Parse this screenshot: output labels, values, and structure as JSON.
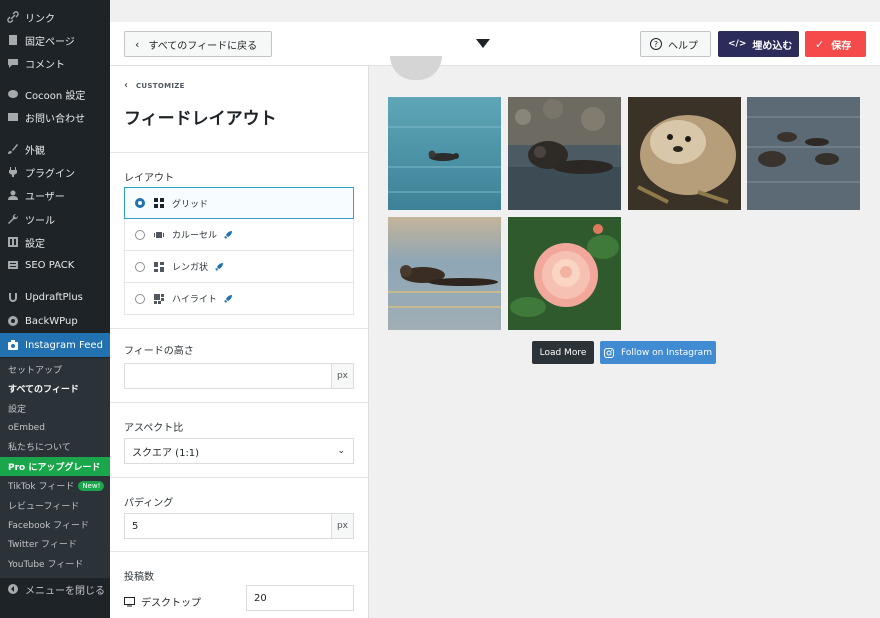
{
  "sidebar": {
    "items": [
      {
        "label": "リンク",
        "icon": "link-icon"
      },
      {
        "label": "固定ページ",
        "icon": "page-icon"
      },
      {
        "label": "コメント",
        "icon": "comment-icon"
      },
      {
        "label": "Cocoon 設定",
        "icon": "cocoon-icon"
      },
      {
        "label": "お問い合わせ",
        "icon": "mail-icon"
      },
      {
        "label": "外観",
        "icon": "brush-icon"
      },
      {
        "label": "プラグイン",
        "icon": "plugin-icon"
      },
      {
        "label": "ユーザー",
        "icon": "user-icon"
      },
      {
        "label": "ツール",
        "icon": "wrench-icon"
      },
      {
        "label": "設定",
        "icon": "settings-icon"
      },
      {
        "label": "SEO PACK",
        "icon": "seo-icon"
      },
      {
        "label": "UpdraftPlus",
        "icon": "updraft-icon"
      },
      {
        "label": "BackWPup",
        "icon": "backwpup-icon"
      },
      {
        "label": "Instagram Feed",
        "icon": "camera-icon"
      }
    ],
    "submenu": [
      {
        "label": "セットアップ"
      },
      {
        "label": "すべてのフィード"
      },
      {
        "label": "設定"
      },
      {
        "label": "oEmbed"
      },
      {
        "label": "私たちについて"
      },
      {
        "label": "Pro にアップグレード"
      },
      {
        "label": "TikTok フィード",
        "badge": "New!"
      },
      {
        "label": "レビューフィード"
      },
      {
        "label": "Facebook フィード"
      },
      {
        "label": "Twitter フィード"
      },
      {
        "label": "YouTube フィード"
      }
    ],
    "collapse_label": "メニューを閉じる"
  },
  "header": {
    "back_label": "すべてのフィードに戻る",
    "help_label": "ヘルプ",
    "embed_label": "埋め込む",
    "save_label": "保存"
  },
  "panel": {
    "breadcrumb": "CUSTOMIZE",
    "title": "フィードレイアウト",
    "layout_label": "レイアウト",
    "layout_options": [
      {
        "label": "グリッド",
        "selected": true,
        "pro": false
      },
      {
        "label": "カルーセル",
        "selected": false,
        "pro": true
      },
      {
        "label": "レンガ状",
        "selected": false,
        "pro": true
      },
      {
        "label": "ハイライト",
        "selected": false,
        "pro": true
      }
    ],
    "height_label": "フィードの高さ",
    "height_value": "",
    "height_unit": "px",
    "aspect_label": "アスペクト比",
    "aspect_value": "スクエア (1:1)",
    "padding_label": "パディング",
    "padding_value": "5",
    "padding_unit": "px",
    "posts_label": "投稿数",
    "desktop_label": "デスクトップ",
    "desktop_value": "20"
  },
  "preview": {
    "load_more_label": "Load More",
    "follow_label": "Follow on Instagram"
  },
  "colors": {
    "sidebar_bg": "#1d2327",
    "active_blue": "#2271b1",
    "pro_green": "#1aa64a",
    "embed_navy": "#2c2c5a",
    "save_red": "#f44a4a",
    "follow_blue": "#408bd1"
  }
}
